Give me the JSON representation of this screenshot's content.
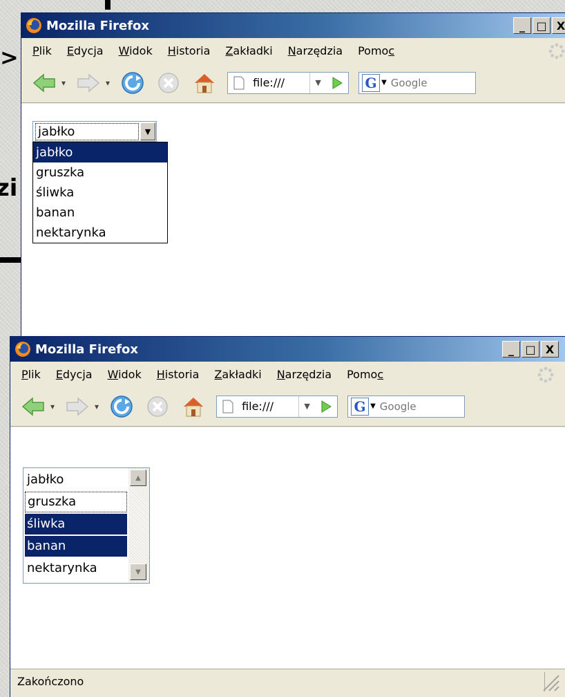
{
  "slide_fragments": {
    "angle_text": ">",
    "partial_text": "zi"
  },
  "window_top": {
    "title": "Mozilla Firefox",
    "controls": {
      "minimize": "_",
      "maximize": "□",
      "close": "X"
    },
    "menu": [
      {
        "label": "Plik",
        "accel": "P"
      },
      {
        "label": "Edycja",
        "accel": "E"
      },
      {
        "label": "Widok",
        "accel": "W"
      },
      {
        "label": "Historia",
        "accel": "H"
      },
      {
        "label": "Zakładki",
        "accel": "Z"
      },
      {
        "label": "Narzędzia",
        "accel": "N"
      },
      {
        "label": "Pomoc",
        "accel": "c"
      }
    ],
    "url": "file:///",
    "search_placeholder": "Google",
    "select": {
      "value": "jabłko",
      "options": [
        "jabłko",
        "gruszka",
        "śliwka",
        "banan",
        "nektarynka"
      ],
      "highlighted": "jabłko"
    }
  },
  "window_bottom": {
    "title": "Mozilla Firefox",
    "controls": {
      "minimize": "_",
      "maximize": "□",
      "close": "X"
    },
    "menu": [
      {
        "label": "Plik",
        "accel": "P"
      },
      {
        "label": "Edycja",
        "accel": "E"
      },
      {
        "label": "Widok",
        "accel": "W"
      },
      {
        "label": "Historia",
        "accel": "H"
      },
      {
        "label": "Zakładki",
        "accel": "Z"
      },
      {
        "label": "Narzędzia",
        "accel": "N"
      },
      {
        "label": "Pomoc",
        "accel": "c"
      }
    ],
    "url": "file:///",
    "search_placeholder": "Google",
    "listbox": {
      "options": [
        "jabłko",
        "gruszka",
        "śliwka",
        "banan",
        "nektarynka"
      ],
      "selected": [
        "śliwka",
        "banan"
      ],
      "focused": "gruszka"
    },
    "status": "Zakończono"
  },
  "colors": {
    "titlebar_start": "#0a246a",
    "titlebar_end": "#a6caf0",
    "selection": "#0a246a",
    "chrome": "#ece9d8"
  },
  "icons": [
    "firefox-logo-icon",
    "back-arrow-icon",
    "forward-arrow-icon",
    "reload-icon",
    "stop-icon",
    "home-icon",
    "page-icon",
    "go-arrow-icon",
    "google-g-icon",
    "throbber-icon",
    "resize-grip-icon"
  ]
}
